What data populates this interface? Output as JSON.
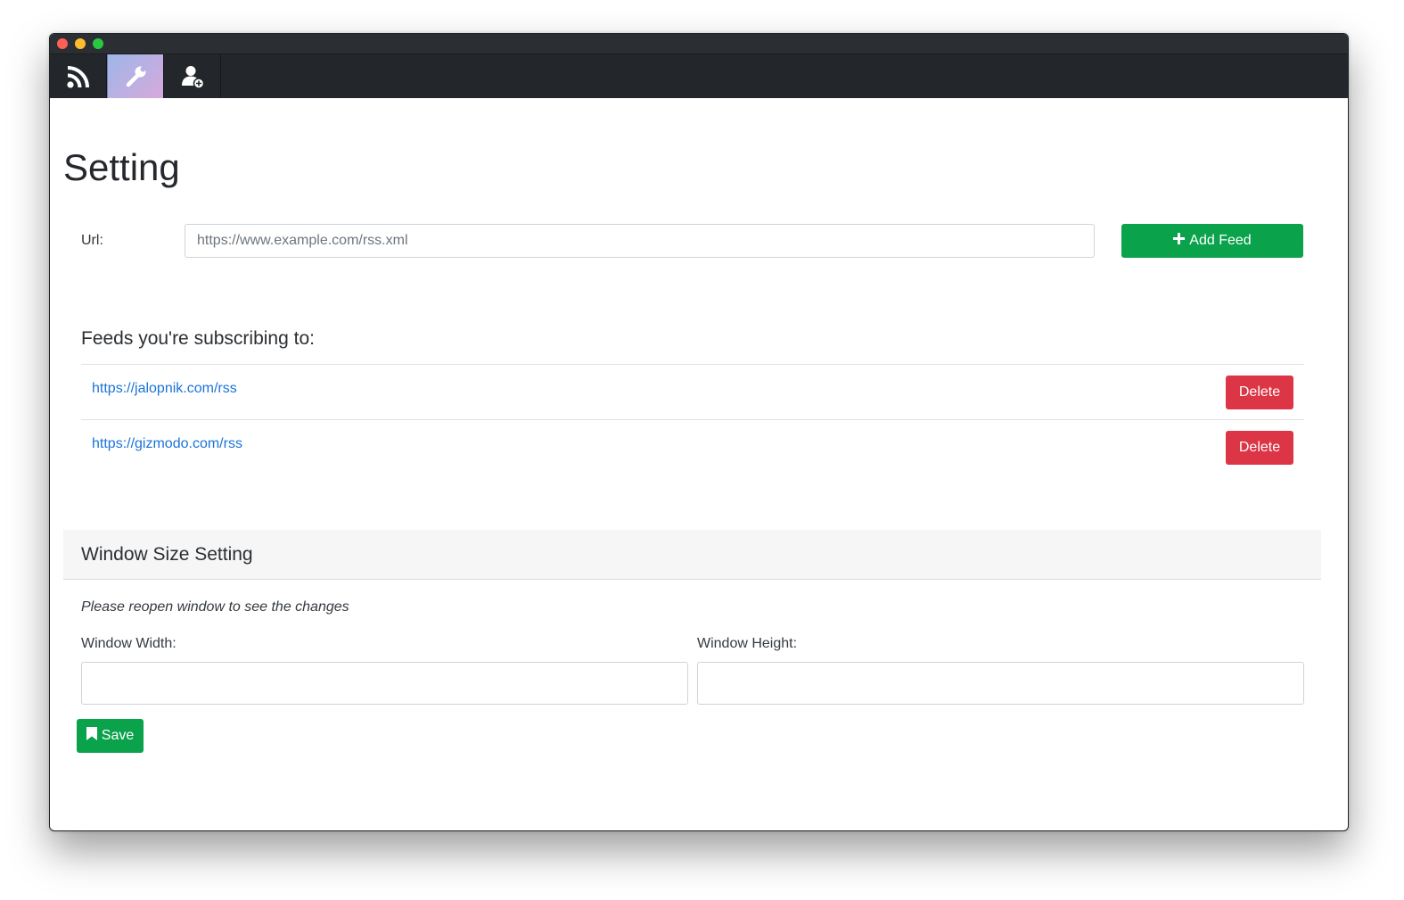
{
  "window": {
    "controls": [
      "close",
      "minimize",
      "maximize"
    ]
  },
  "navbar": {
    "items": [
      {
        "icon": "rss-icon",
        "active": false
      },
      {
        "icon": "wrench-icon",
        "active": true
      },
      {
        "icon": "add-user-icon",
        "active": false
      }
    ]
  },
  "page": {
    "title": "Setting"
  },
  "url_form": {
    "label": "Url:",
    "placeholder": "https://www.example.com/rss.xml",
    "value": "",
    "add_button_label": "Add Feed",
    "add_button_icon": "plus-icon"
  },
  "feeds": {
    "heading": "Feeds you're subscribing to:",
    "items": [
      {
        "url": "https://jalopnik.com/rss",
        "delete_label": "Delete"
      },
      {
        "url": "https://gizmodo.com/rss",
        "delete_label": "Delete"
      }
    ]
  },
  "window_size": {
    "title": "Window Size Setting",
    "note": "Please reopen window to see the changes",
    "width_label": "Window Width:",
    "width_value": "",
    "height_label": "Window Height:",
    "height_value": "",
    "save_label": "Save",
    "save_icon": "bookmark-icon"
  },
  "colors": {
    "navbar_bg": "#23272b",
    "success": "#0aa24b",
    "danger": "#dc3545",
    "link": "#1a73d9",
    "panel_header_bg": "#f6f6f6"
  }
}
